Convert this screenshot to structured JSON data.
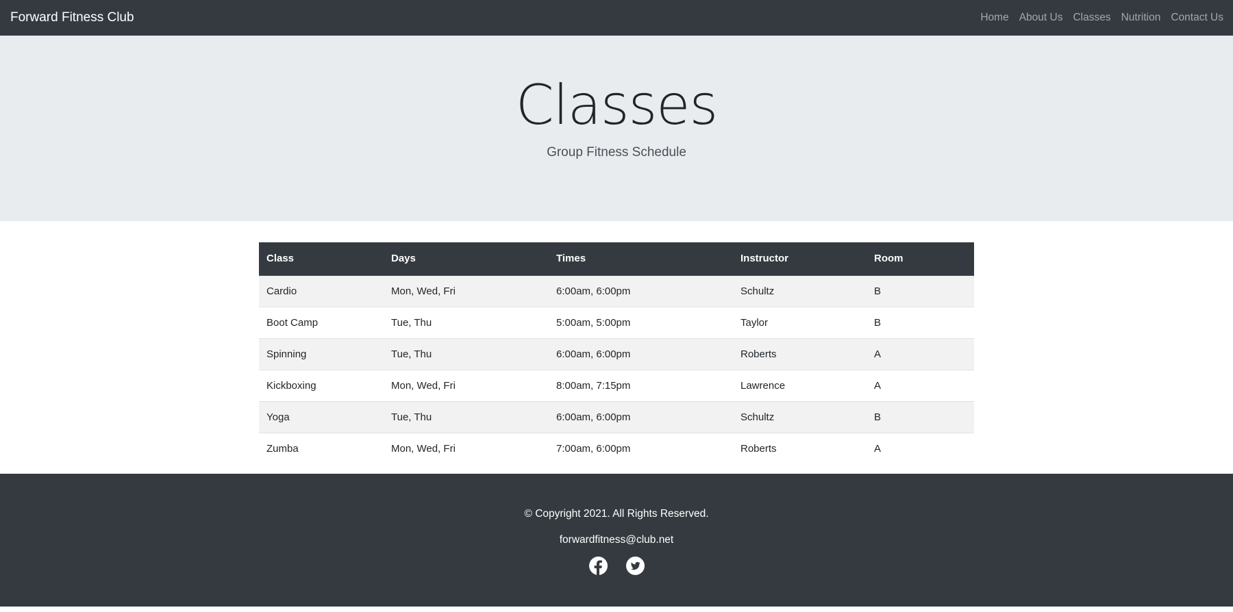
{
  "navbar": {
    "brand": "Forward Fitness Club",
    "links": [
      "Home",
      "About Us",
      "Classes",
      "Nutrition",
      "Contact Us"
    ]
  },
  "hero": {
    "title": "Classes",
    "subtitle": "Group Fitness Schedule"
  },
  "schedule": {
    "headers": [
      "Class",
      "Days",
      "Times",
      "Instructor",
      "Room"
    ],
    "rows": [
      [
        "Cardio",
        "Mon, Wed, Fri",
        "6:00am, 6:00pm",
        "Schultz",
        "B"
      ],
      [
        "Boot Camp",
        "Tue, Thu",
        "5:00am, 5:00pm",
        "Taylor",
        "B"
      ],
      [
        "Spinning",
        "Tue, Thu",
        "6:00am, 6:00pm",
        "Roberts",
        "A"
      ],
      [
        "Kickboxing",
        "Mon, Wed, Fri",
        "8:00am, 7:15pm",
        "Lawrence",
        "A"
      ],
      [
        "Yoga",
        "Tue, Thu",
        "6:00am, 6:00pm",
        "Schultz",
        "B"
      ],
      [
        "Zumba",
        "Mon, Wed, Fri",
        "7:00am, 6:00pm",
        "Roberts",
        "A"
      ]
    ]
  },
  "footer": {
    "copyright": "© Copyright 2021. All Rights Reserved.",
    "email": "forwardfitness@club.net",
    "social_icons": [
      "facebook-icon",
      "twitter-icon"
    ]
  },
  "colors": {
    "navbar_bg": "#343a40",
    "hero_bg": "#e9ecef",
    "stripe_bg": "#f2f2f2"
  }
}
